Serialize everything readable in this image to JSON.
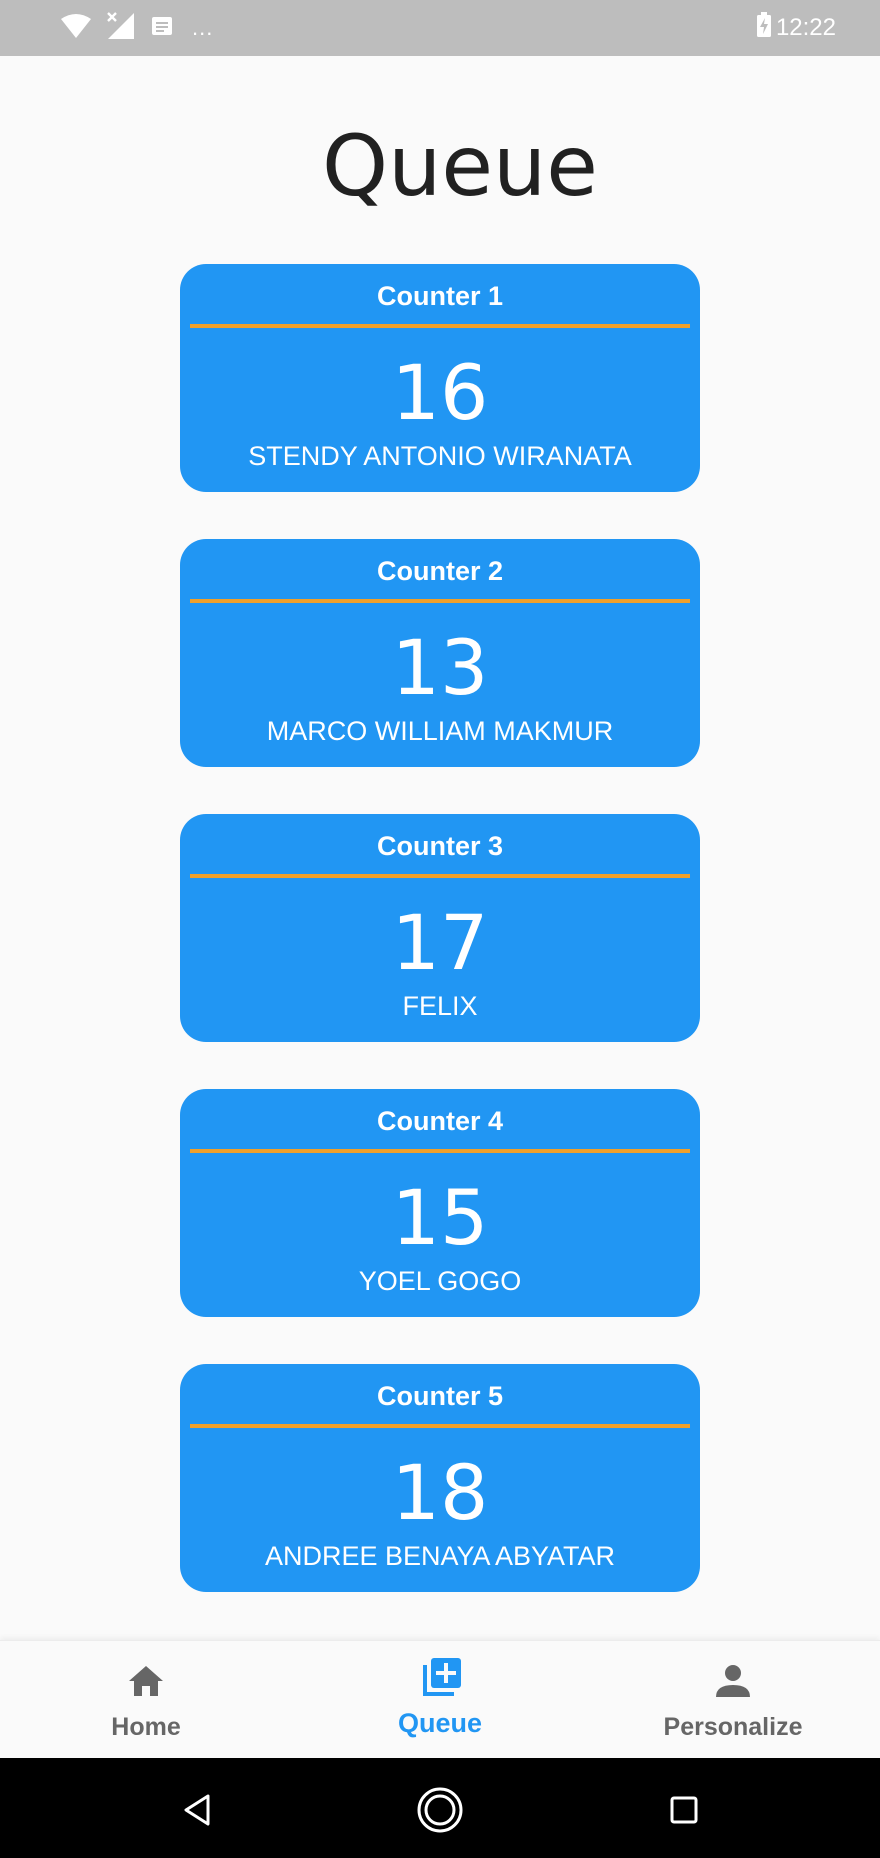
{
  "status_bar": {
    "time": "12:22",
    "dots": "...",
    "icons": [
      "wifi-icon",
      "no-signal-icon",
      "notification-icon",
      "battery-charging-icon"
    ]
  },
  "page": {
    "title": "Queue"
  },
  "counters": [
    {
      "label": "Counter 1",
      "number": "16",
      "name": "STENDY ANTONIO WIRANATA"
    },
    {
      "label": "Counter 2",
      "number": "13",
      "name": "MARCO WILLIAM MAKMUR"
    },
    {
      "label": "Counter 3",
      "number": "17",
      "name": "FELIX"
    },
    {
      "label": "Counter 4",
      "number": "15",
      "name": "YOEL GOGO"
    },
    {
      "label": "Counter 5",
      "number": "18",
      "name": "ANDREE BENAYA ABYATAR"
    }
  ],
  "bottom_nav": {
    "items": [
      {
        "label": "Home",
        "icon": "home-icon",
        "active": false
      },
      {
        "label": "Queue",
        "icon": "queue-add-icon",
        "active": true
      },
      {
        "label": "Personalize",
        "icon": "person-icon",
        "active": false
      }
    ]
  },
  "colors": {
    "card": "#2196f3",
    "divider": "#f0a02a",
    "active_nav": "#2196f3",
    "inactive_nav": "#666666",
    "status_bar": "#bdbdbd"
  }
}
